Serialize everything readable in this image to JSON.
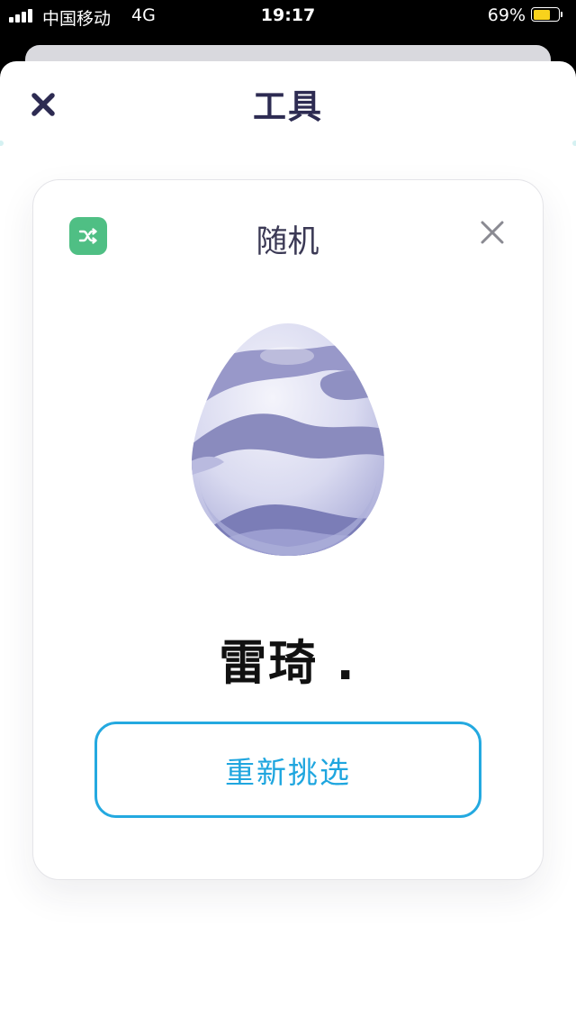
{
  "status_bar": {
    "carrier": "中国移动",
    "network": "4G",
    "time": "19:17",
    "battery_percent": "69%",
    "battery_level": 0.69,
    "battery_color": "#f8d21c",
    "signal_icon": "signal-bars-icon",
    "battery_icon": "battery-icon"
  },
  "sheet": {
    "title": "工具",
    "close_icon": "close-icon",
    "title_color": "#2d2b52"
  },
  "tool_card": {
    "title": "随机",
    "badge_icon": "shuffle-icon",
    "badge_color": "#4fbf84",
    "close_icon": "close-icon",
    "image_icon": "egg-icon",
    "result_name": "雷琦 .",
    "repick_label": "重新挑选",
    "accent_color": "#24a9e0"
  }
}
